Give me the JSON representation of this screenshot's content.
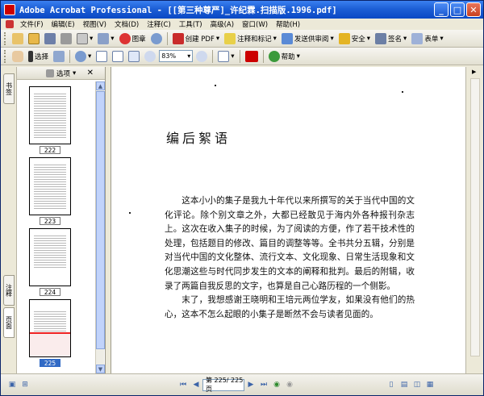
{
  "window": {
    "title": "Adobe Acrobat Professional - [[第三种尊严]_许纪霖.扫描版.1996.pdf]"
  },
  "menu": {
    "items": [
      "文件(F)",
      "编辑(E)",
      "视图(V)",
      "文档(D)",
      "注释(C)",
      "工具(T)",
      "高级(A)",
      "窗口(W)",
      "帮助(H)"
    ]
  },
  "toolbar1": {
    "create_pdf": "创建 PDF",
    "comment_markup": "注释和标记",
    "send_review": "发送供审阅",
    "security": "安全",
    "sign": "签名",
    "forms": "表单",
    "organizer": "图章"
  },
  "toolbar2": {
    "select": "选择",
    "zoom_value": "83%",
    "help": "帮助"
  },
  "nav_tabs": {
    "bookmarks": "书签",
    "comments": "注释",
    "pages": "页面"
  },
  "panel": {
    "options": "选项"
  },
  "thumbnails": [
    {
      "label": "222",
      "selected": false
    },
    {
      "label": "223",
      "selected": false
    },
    {
      "label": "224",
      "selected": false
    },
    {
      "label": "225",
      "selected": true
    }
  ],
  "document": {
    "heading": "编后絮语",
    "paragraphs": [
      "这本小小的集子是我九十年代以来所撰写的关于当代中国的文化评论。除个别文章之外，大都已经散见于海内外各种报刊杂志上。这次在收入集子的时候，为了阅读的方便，作了若干技术性的处理，包括题目的修改、篇目的调整等等。全书共分五辑，分别是对当代中国的文化整体、流行文本、文化现象、日常生活现象和文化思潮这些与时代同步发生的文本的阐释和批判。最后的附辑，收录了两篇自我反思的文字，也算是自己心路历程的一个侧影。",
      "末了，我想感谢王晓明和王培元两位学友，如果没有他们的热心，这本不怎么起眼的小集子是断然不会与读者见面的。"
    ]
  },
  "status": {
    "page_display": "第 225/ 225 页"
  }
}
